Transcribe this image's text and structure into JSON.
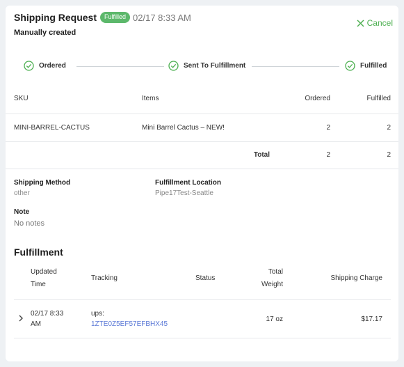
{
  "header": {
    "title": "Shipping Request",
    "status_badge": "Fulfilled",
    "timestamp": "02/17 8:33 AM",
    "subtitle": "Manually created",
    "cancel_label": "Cancel"
  },
  "progress_steps": [
    {
      "label": "Ordered",
      "state": "complete"
    },
    {
      "label": "Sent To Fulfillment",
      "state": "complete"
    },
    {
      "label": "Fulfilled",
      "state": "complete"
    }
  ],
  "items_table": {
    "headers": {
      "sku": "SKU",
      "items": "Items",
      "ordered": "Ordered",
      "fulfilled": "Fulfilled"
    },
    "rows": [
      {
        "sku": "MINI-BARREL-CACTUS",
        "item": "Mini Barrel Cactus – NEW!",
        "ordered": "2",
        "fulfilled": "2"
      }
    ],
    "total": {
      "label": "Total",
      "ordered": "2",
      "fulfilled": "2"
    }
  },
  "details": {
    "shipping_method_label": "Shipping Method",
    "shipping_method_value": "other",
    "fulfillment_location_label": "Fulfillment Location",
    "fulfillment_location_value": "Pipe17Test-Seattle",
    "note_label": "Note",
    "note_value": "No notes"
  },
  "fulfillment": {
    "section_title": "Fulfillment",
    "headers": {
      "updated_time_1": "Updated",
      "updated_time_2": "Time",
      "tracking": "Tracking",
      "status": "Status",
      "total_weight_1": "Total",
      "total_weight_2": "Weight",
      "shipping_charge": "Shipping Charge"
    },
    "rows": [
      {
        "updated_1": "02/17 8:33",
        "updated_2": "AM",
        "carrier": "ups:",
        "tracking_number": "1ZTE0Z5EF57EFBHX45",
        "status": "",
        "total_weight": "17 oz",
        "shipping_charge": "$17.17"
      }
    ]
  },
  "colors": {
    "accent_green": "#4caf50",
    "badge_green": "#5cb86b",
    "link_blue": "#5a78d6"
  },
  "icons": {
    "close": "close-icon",
    "step_complete": "check-circle-icon",
    "expand": "chevron-right-icon"
  }
}
